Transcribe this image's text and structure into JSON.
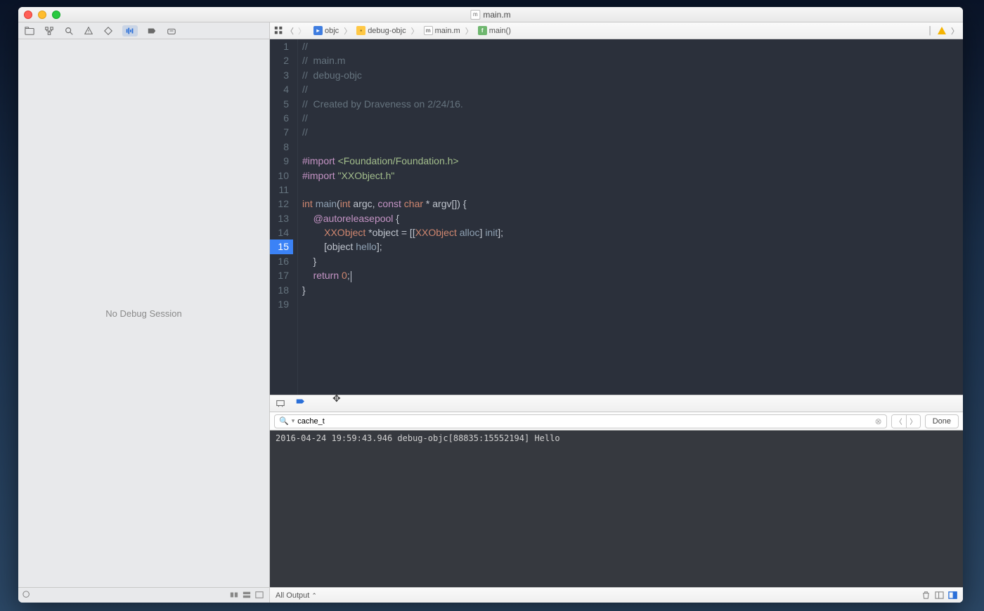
{
  "titlebar": {
    "title": "main.m"
  },
  "sidebar": {
    "placeholder": "No Debug Session"
  },
  "jumpbar": {
    "segments": [
      {
        "icon": "proj",
        "label": "objc"
      },
      {
        "icon": "folder",
        "label": "debug-objc"
      },
      {
        "icon": "file",
        "label": "main.m"
      },
      {
        "icon": "func",
        "label": "main()"
      }
    ]
  },
  "editor": {
    "current_line": 15,
    "lines": [
      {
        "n": 1,
        "t": "comment",
        "text": "//"
      },
      {
        "n": 2,
        "t": "comment",
        "text": "//  main.m"
      },
      {
        "n": 3,
        "t": "comment",
        "text": "//  debug-objc"
      },
      {
        "n": 4,
        "t": "comment",
        "text": "//"
      },
      {
        "n": 5,
        "t": "comment",
        "text": "//  Created by Draveness on 2/24/16."
      },
      {
        "n": 6,
        "t": "comment",
        "text": "//"
      },
      {
        "n": 7,
        "t": "comment",
        "text": "//"
      },
      {
        "n": 8,
        "t": "blank",
        "text": ""
      },
      {
        "n": 9,
        "t": "import1",
        "text": "#import <Foundation/Foundation.h>"
      },
      {
        "n": 10,
        "t": "import2",
        "text": "#import \"XXObject.h\""
      },
      {
        "n": 11,
        "t": "blank",
        "text": ""
      },
      {
        "n": 12,
        "t": "sig",
        "text": "int main(int argc, const char * argv[]) {"
      },
      {
        "n": 13,
        "t": "auto",
        "text": "    @autoreleasepool {"
      },
      {
        "n": 14,
        "t": "alloc",
        "text": "        XXObject *object = [[XXObject alloc] init];"
      },
      {
        "n": 15,
        "t": "call",
        "text": "        [object hello];"
      },
      {
        "n": 16,
        "t": "close",
        "text": "    }"
      },
      {
        "n": 17,
        "t": "return",
        "text": "    return 0;"
      },
      {
        "n": 18,
        "t": "close",
        "text": "}"
      },
      {
        "n": 19,
        "t": "blank",
        "text": ""
      }
    ]
  },
  "search": {
    "value": "cache_t",
    "done_label": "Done"
  },
  "console": {
    "output": "2016-04-24 19:59:43.946 debug-objc[88835:15552194] Hello"
  },
  "console_footer": {
    "filter_label": "All Output"
  }
}
